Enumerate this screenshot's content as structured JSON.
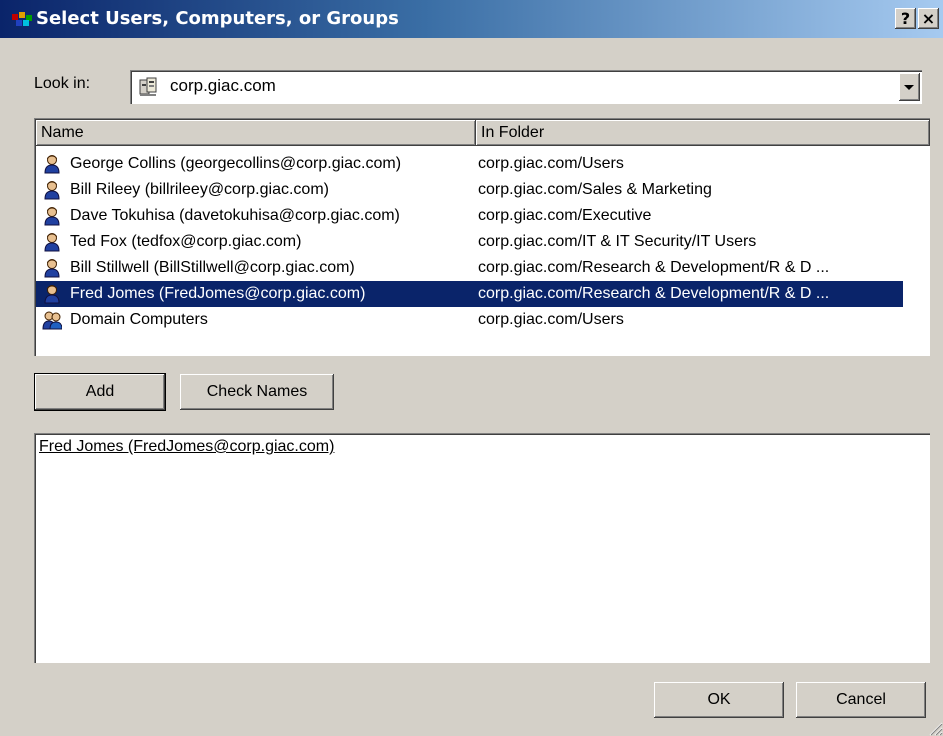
{
  "window": {
    "title": "Select Users, Computers, or Groups",
    "help_glyph": "?",
    "close_glyph": "×"
  },
  "lookin": {
    "label": "Look in:",
    "value": "corp.giac.com"
  },
  "list": {
    "columns": [
      "Name",
      "In Folder"
    ],
    "rows": [
      {
        "name": "George Collins (georgecollins@corp.giac.com)",
        "folder": "corp.giac.com/Users",
        "icon": "user-icon"
      },
      {
        "name": "Bill Rileey (billrileey@corp.giac.com)",
        "folder": "corp.giac.com/Sales & Marketing",
        "icon": "user-icon"
      },
      {
        "name": "Dave Tokuhisa (davetokuhisa@corp.giac.com)",
        "folder": "corp.giac.com/Executive",
        "icon": "user-icon"
      },
      {
        "name": "Ted Fox (tedfox@corp.giac.com)",
        "folder": "corp.giac.com/IT & IT Security/IT Users",
        "icon": "user-icon"
      },
      {
        "name": "Bill Stillwell (BillStillwell@corp.giac.com)",
        "folder": "corp.giac.com/Research & Development/R & D ...",
        "icon": "user-icon"
      },
      {
        "name": "Fred Jomes (FredJomes@corp.giac.com)",
        "folder": "corp.giac.com/Research & Development/R & D ...",
        "icon": "user-icon",
        "selected": true
      },
      {
        "name": "Domain Computers",
        "folder": "corp.giac.com/Users",
        "icon": "group-icon"
      }
    ]
  },
  "buttons": {
    "add": "Add",
    "check_names": "Check Names",
    "ok": "OK",
    "cancel": "Cancel"
  },
  "selected_objects": [
    "Fred Jomes (FredJomes@corp.giac.com)"
  ],
  "colors": {
    "face": "#d4d0c8",
    "selection": "#0a246a",
    "titlebar_start": "#0a246a",
    "titlebar_end": "#a6caf0"
  }
}
